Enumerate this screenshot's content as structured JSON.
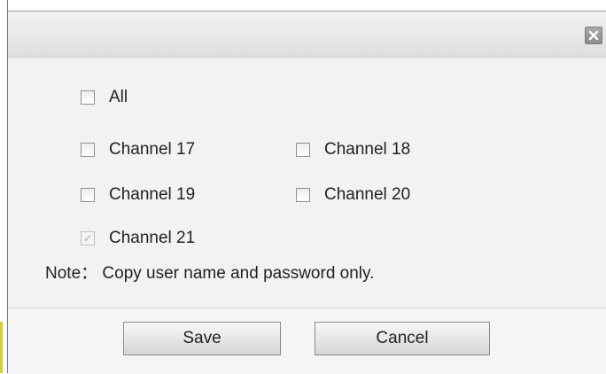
{
  "dialog": {
    "close_icon": "close-icon"
  },
  "options": {
    "all": {
      "label": "All",
      "checked": false,
      "disabled": false
    },
    "ch17": {
      "label": "Channel 17",
      "checked": false,
      "disabled": false
    },
    "ch18": {
      "label": "Channel 18",
      "checked": false,
      "disabled": false
    },
    "ch19": {
      "label": "Channel 19",
      "checked": false,
      "disabled": false
    },
    "ch20": {
      "label": "Channel 20",
      "checked": false,
      "disabled": false
    },
    "ch21": {
      "label": "Channel 21",
      "checked": true,
      "disabled": true
    }
  },
  "note": "Note： Copy user name and password only.",
  "buttons": {
    "save": "Save",
    "cancel": "Cancel"
  },
  "colors": {
    "dialog_bg": "#f2f2f2",
    "titlebar": "#e6e6e6",
    "close_button": "#999999"
  }
}
